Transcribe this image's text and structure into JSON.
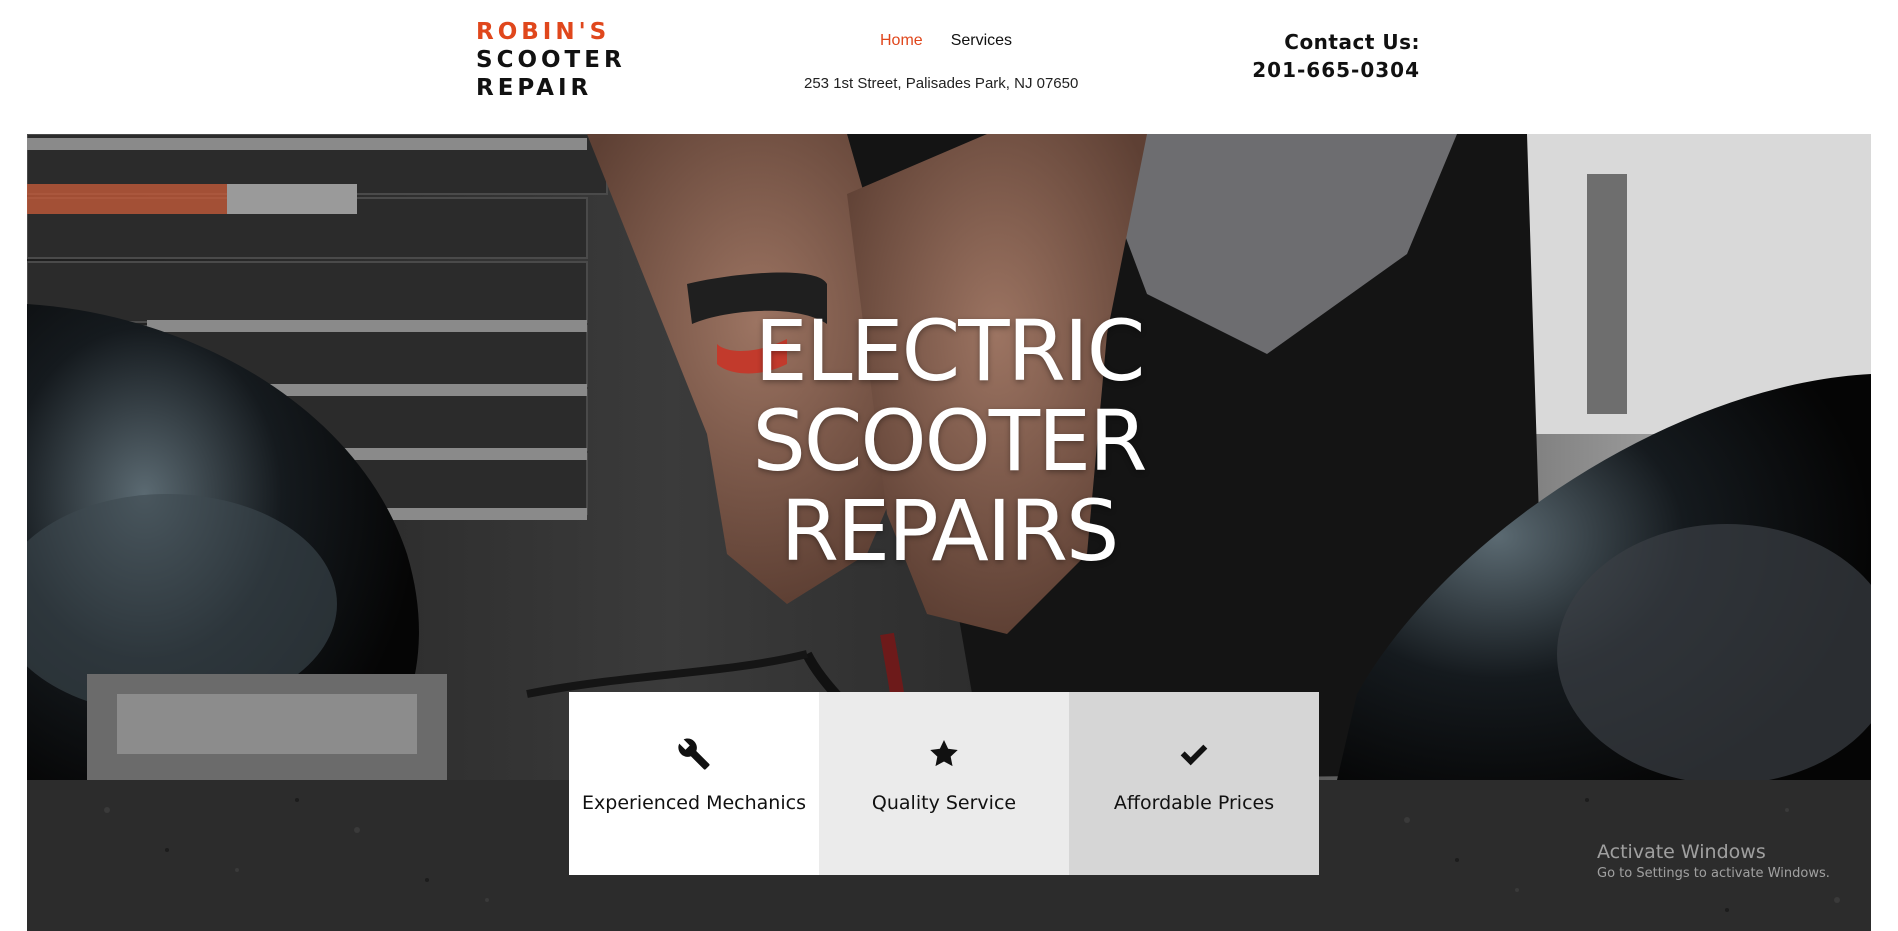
{
  "header": {
    "logo_line1": "ROBIN'S",
    "logo_line2": "SCOOTER",
    "logo_line3": "REPAIR",
    "nav": [
      {
        "label": "Home",
        "active": true
      },
      {
        "label": "Services",
        "active": false
      }
    ],
    "address": "253 1st Street, Palisades Park, NJ 07650",
    "contact_label": "Contact Us:",
    "contact_phone": "201-665-0304"
  },
  "hero": {
    "title_line1": "ELECTRIC",
    "title_line2": "SCOOTER",
    "title_line3": "REPAIRS"
  },
  "features": [
    {
      "label": "Experienced Mechanics",
      "icon": "wrench-icon",
      "bg": "#ffffff"
    },
    {
      "label": "Quality Service",
      "icon": "star-icon",
      "bg": "#ebebeb"
    },
    {
      "label": "Affordable Prices",
      "icon": "checkmark-icon",
      "bg": "#d6d6d6"
    }
  ],
  "watermark": {
    "title": "Activate Windows",
    "subtitle": "Go to Settings to activate Windows."
  },
  "colors": {
    "brand_accent": "#e0471c",
    "text_dark": "#111111"
  }
}
